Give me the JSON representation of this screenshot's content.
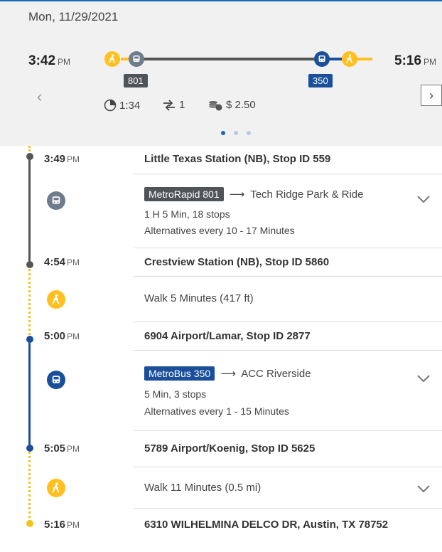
{
  "date": "Mon, 11/29/2021",
  "summary": {
    "depart_time": "3:42",
    "depart_ampm": "PM",
    "arrive_time": "5:16",
    "arrive_ampm": "PM",
    "route_1": "801",
    "route_2": "350",
    "duration": "1:34",
    "transfers": "1",
    "fare": "$ 2.50"
  },
  "itinerary": {
    "stop_1": {
      "time": "3:49",
      "ampm": "PM",
      "name": "Little Texas Station (NB), Stop ID 559"
    },
    "leg_1": {
      "route_label": "MetroRapid 801",
      "arrow": "⟶",
      "destination": "Tech Ridge Park & Ride",
      "duration_stops": "1 H 5 Min, 18 stops",
      "alternatives": "Alternatives every 10 - 17 Minutes"
    },
    "stop_2": {
      "time": "4:54",
      "ampm": "PM",
      "name": "Crestview Station (NB), Stop ID 5860"
    },
    "walk_1": "Walk 5 Minutes (417 ft)",
    "stop_3": {
      "time": "5:00",
      "ampm": "PM",
      "name": "6904 Airport/Lamar, Stop ID 2877"
    },
    "leg_2": {
      "route_label": "MetroBus 350",
      "arrow": "⟶",
      "destination": "ACC Riverside",
      "duration_stops": "5 Min, 3 stops",
      "alternatives": "Alternatives every 1 - 15 Minutes"
    },
    "stop_4": {
      "time": "5:05",
      "ampm": "PM",
      "name": "5789 Airport/Koenig, Stop ID 5625"
    },
    "walk_2": "Walk 11 Minutes (0.5 mi)",
    "stop_5": {
      "time": "5:16",
      "ampm": "PM",
      "name": "6310 WILHELMINA DELCO DR, Austin, TX 78752"
    }
  },
  "colors": {
    "accent_blue": "#1e68b3",
    "bus_gray": "#4f5458",
    "metrobus_blue": "#1b4f9a",
    "walk_yellow": "#ffc020"
  }
}
